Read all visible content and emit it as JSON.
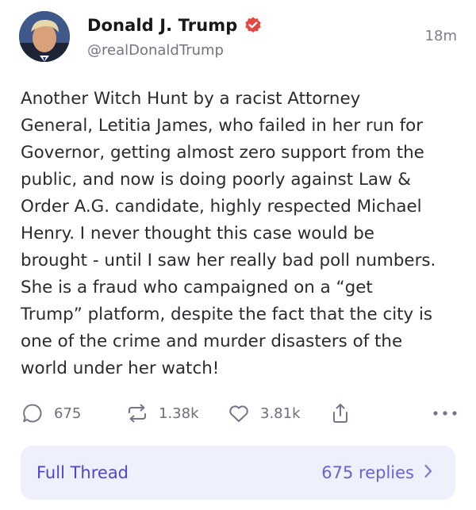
{
  "post": {
    "author": {
      "display_name": "Donald J. Trump",
      "handle": "@realDonaldTrump",
      "verified": true,
      "verified_color": "#e6463f"
    },
    "timestamp": "18m",
    "body": "Another Witch Hunt by a racist Attorney\nGeneral, Letitia James, who failed in her run for\nGovernor, getting almost zero support from the\npublic, and now is doing poorly against Law &\nOrder A.G. candidate, highly respected Michael\nHenry. I never thought this case would be\nbrought - until I saw her really bad poll numbers.\nShe is a fraud who campaigned on a “get\nTrump” platform, despite the fact that the city is\none of the crime and murder disasters of the\nworld under her watch!",
    "actions": {
      "replies": {
        "icon": "reply-icon",
        "count": "675"
      },
      "retruths": {
        "icon": "repost-icon",
        "count": "1.38k"
      },
      "likes": {
        "icon": "heart-icon",
        "count": "3.81k"
      },
      "share": {
        "icon": "share-icon"
      },
      "more": {
        "icon": "more-horizontal-icon"
      }
    },
    "thread": {
      "label": "Full Thread",
      "replies": "675 replies",
      "accent": "#4f46c8"
    }
  }
}
